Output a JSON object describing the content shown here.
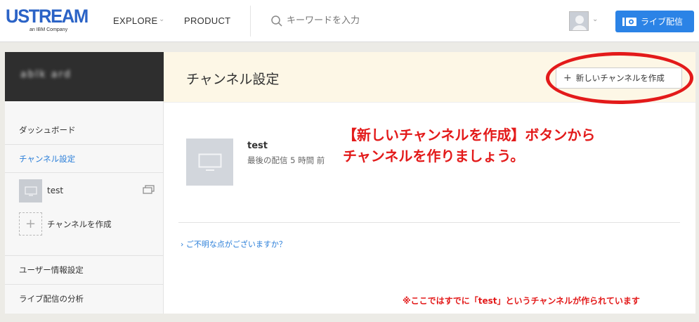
{
  "header": {
    "logo_main": "USTREAM",
    "logo_sub": "an IBM Company",
    "nav_explore": "EXPLORE",
    "nav_product": "PRODUCT",
    "search_placeholder": "キーワードを入力",
    "live_button": "ライブ配信"
  },
  "sidebar": {
    "username": "ablk ard",
    "items": [
      {
        "label": "ダッシュボード"
      },
      {
        "label": "チャンネル設定"
      },
      {
        "label": "ユーザー情報設定"
      },
      {
        "label": "ライブ配信の分析"
      }
    ],
    "channel_name": "test",
    "create_channel": "チャンネルを作成"
  },
  "main": {
    "title": "チャンネル設定",
    "new_channel_button": "新しいチャンネルを作成",
    "channel": {
      "name": "test",
      "last_broadcast": "最後の配信 5 時間 前"
    },
    "help_link": "ご不明な点がございますか？"
  },
  "annotations": {
    "line1": "【新しいチャンネルを作成】ボタンから",
    "line2": "チャンネルを作りましょう。",
    "note": "※ここではすでに「test」というチャンネルが作られています",
    "color": "#e31a1a"
  },
  "colors": {
    "brand": "#2b63c6",
    "accent": "#2b83e6",
    "link": "#2b7fd9"
  }
}
